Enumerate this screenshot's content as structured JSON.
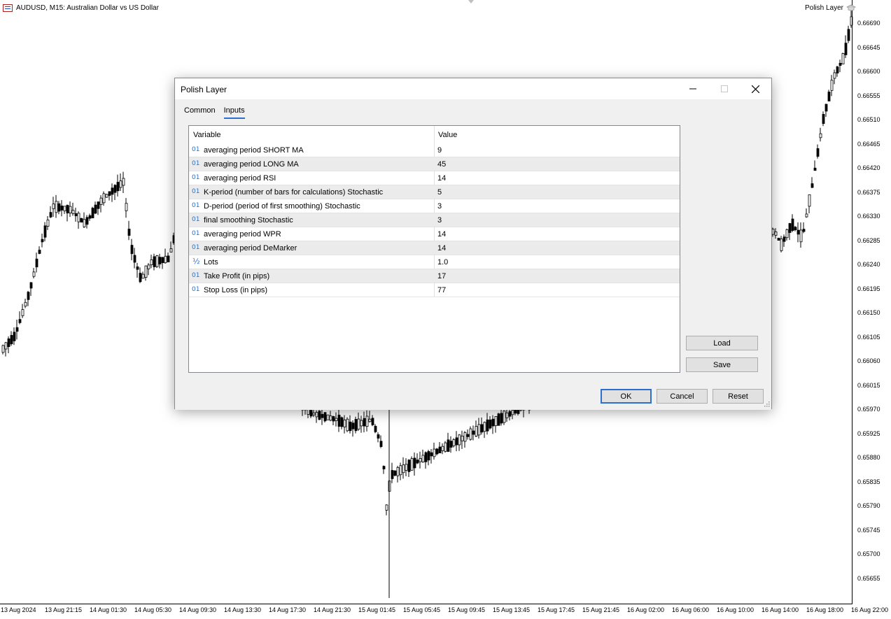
{
  "chart": {
    "title": "AUDUSD, M15:  Australian Dollar vs US Dollar",
    "ea_name": "Polish Layer",
    "price_labels": [
      "0.66690",
      "0.66645",
      "0.66600",
      "0.66555",
      "0.66510",
      "0.66465",
      "0.66420",
      "0.66375",
      "0.66330",
      "0.66285",
      "0.66240",
      "0.66195",
      "0.66150",
      "0.66105",
      "0.66060",
      "0.66015",
      "0.65970",
      "0.65925",
      "0.65880",
      "0.65835",
      "0.65790",
      "0.65745",
      "0.65700",
      "0.65655"
    ],
    "time_labels": [
      "13 Aug 2024",
      "13 Aug 21:15",
      "14 Aug 01:30",
      "14 Aug 05:30",
      "14 Aug 09:30",
      "14 Aug 13:30",
      "14 Aug 17:30",
      "14 Aug 21:30",
      "15 Aug 01:45",
      "15 Aug 05:45",
      "15 Aug 09:45",
      "15 Aug 13:45",
      "15 Aug 17:45",
      "15 Aug 21:45",
      "16 Aug 02:00",
      "16 Aug 06:00",
      "16 Aug 10:00",
      "16 Aug 14:00",
      "16 Aug 18:00",
      "16 Aug 22:00"
    ],
    "colors": {
      "candle": "#000000",
      "axis": "#000000",
      "background": "#ffffff"
    }
  },
  "dialog": {
    "title": "Polish Layer",
    "tabs": [
      {
        "label": "Common",
        "active": false
      },
      {
        "label": "Inputs",
        "active": true
      }
    ],
    "table": {
      "col_variable": "Variable",
      "col_value": "Value",
      "rows": [
        {
          "type": "01",
          "name": "averaging period SHORT MA",
          "value": "9"
        },
        {
          "type": "01",
          "name": "averaging period LONG MA",
          "value": "45"
        },
        {
          "type": "01",
          "name": "averaging period RSI",
          "value": "14"
        },
        {
          "type": "01",
          "name": "K-period (number of bars for calculations) Stochastic",
          "value": "5"
        },
        {
          "type": "01",
          "name": "D-period (period of first smoothing) Stochastic",
          "value": "3"
        },
        {
          "type": "01",
          "name": "final smoothing Stochastic",
          "value": "3"
        },
        {
          "type": "01",
          "name": "averaging period WPR",
          "value": "14"
        },
        {
          "type": "01",
          "name": "averaging period DeMarker",
          "value": "14"
        },
        {
          "type": "½",
          "name": "Lots",
          "value": "1.0"
        },
        {
          "type": "01",
          "name": "Take Profit (in pips)",
          "value": "17"
        },
        {
          "type": "01",
          "name": "Stop Loss (in pips)",
          "value": "77"
        }
      ]
    },
    "buttons": {
      "load": "Load",
      "save": "Save",
      "ok": "OK",
      "cancel": "Cancel",
      "reset": "Reset"
    },
    "accent_color": "#2c6fcf"
  }
}
